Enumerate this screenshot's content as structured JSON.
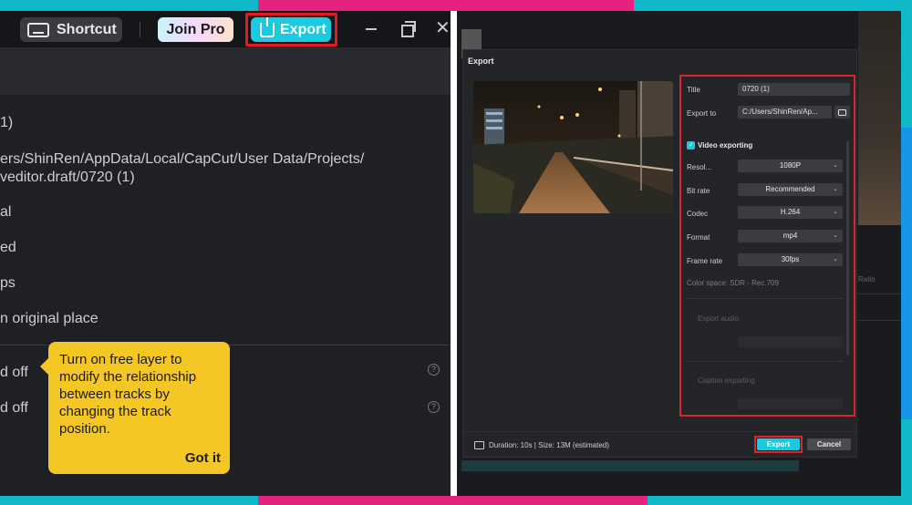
{
  "topbar": {
    "shortcut_label": "Shortcut",
    "join_pro_label": "Join Pro",
    "export_label": "Export"
  },
  "project_info": {
    "rows": [
      "1)",
      "ers/ShinRen/AppData/Local/CapCut/User Data/Projects/",
      "veditor.draft/0720 (1)",
      "al",
      "ed",
      "ps",
      "n original place",
      "d off",
      "d off"
    ]
  },
  "tooltip": {
    "text": "Turn on free layer to modify the relationship between tracks by changing the track position.",
    "action_label": "Got it"
  },
  "export_dialog": {
    "title": "Export",
    "fields": {
      "title_label": "Title",
      "title_value": "0720 (1)",
      "export_to_label": "Export to",
      "export_to_value": "C:/Users/ShinRen/Ap..."
    },
    "video_section": {
      "label": "Video exporting",
      "resolution_label": "Resol...",
      "resolution_value": "1080P",
      "bitrate_label": "Bit rate",
      "bitrate_value": "Recommended",
      "codec_label": "Codec",
      "codec_value": "H.264",
      "format_label": "Format",
      "format_value": "mp4",
      "framerate_label": "Frame rate",
      "framerate_value": "30fps",
      "color_space": "Color space: SDR - Rec.709"
    },
    "audio_section_label": "Export audio",
    "caption_section_label": "Caption exporting",
    "footer": {
      "info": "Duration: 10s | Size: 13M (estimated)",
      "export_label": "Export",
      "cancel_label": "Cancel"
    }
  },
  "background": {
    "ratio_label": "Ratio"
  },
  "colors": {
    "accent": "#1ccae0",
    "highlight": "#e01b24",
    "tooltip_bg": "#f4c725"
  }
}
